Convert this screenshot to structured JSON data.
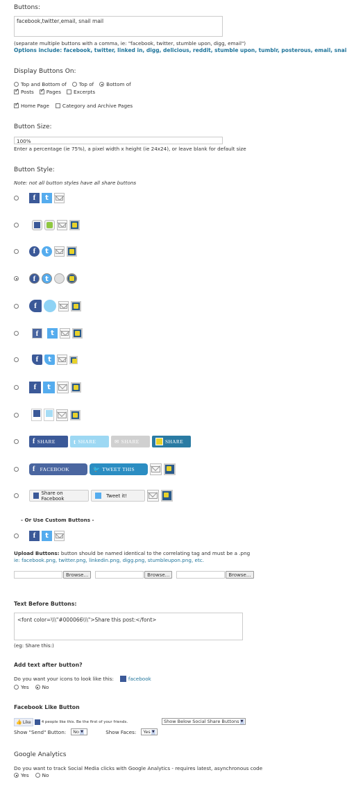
{
  "buttons": {
    "heading": "Buttons:",
    "value": "facebook,twitter,email, snail mail",
    "help": "(separate multiple buttons with a comma, ie: \"facebook, twitter, stumble upon, digg, email\")",
    "options": "Options include: facebook, twitter, linked in, digg, delicious, reddit, stumble upon, tumblr, posterous, email, snail mail,"
  },
  "display": {
    "heading": "Display Buttons On:",
    "positions": [
      "Top and Bottom of",
      "Top of",
      "Bottom of"
    ],
    "types": [
      "Posts",
      "Pages",
      "Excerpts"
    ],
    "home": "Home Page",
    "category": "Category and Archive Pages"
  },
  "size": {
    "heading": "Button Size:",
    "value": "100%",
    "help": "Enter a percentage (ie 75%), a pixel width x height (ie 24x24), or leave blank for default size"
  },
  "style": {
    "heading": "Button Style:",
    "note": "Note: not all button styles have all share buttons",
    "share": "SHARE",
    "facebook": "FACEBOOK",
    "tweet_this": "TWEET THIS",
    "share_on_facebook": "Share on Facebook",
    "tweet_it": "Tweet it!",
    "custom_heading": "- Or Use Custom Buttons -"
  },
  "upload": {
    "heading": "Upload Buttons:",
    "desc": "button should be named identical to the correlating tag and must be a .png",
    "examples": "ie: facebook.png, twitter.png, linkedin.png, digg.png, stumbleupon.png, etc.",
    "browse": "Browse..."
  },
  "text_before": {
    "heading": "Text Before Buttons:",
    "value": "<font color=\\\\\\\"#000066\\\\\\\">Share this post:</font>",
    "example": "(eg: Share this:)"
  },
  "after": {
    "heading": "Add text after button?",
    "question": "Do you want your icons to look like this:",
    "sample": "facebook",
    "yes": "Yes",
    "no": "No"
  },
  "fb_like": {
    "heading": "Facebook Like Button",
    "like": "Like",
    "like_text": "4 people like this. Be the first of your friends.",
    "position": "Show Below Social Share Buttons",
    "send_label": "Show \"Send\" Button:",
    "send_value": "No",
    "faces_label": "Show Faces:",
    "faces_value": "Yes"
  },
  "ga": {
    "heading": "Google Analytics",
    "question": "Do you want to track Social Media clicks with Google Analytics - requires latest, asynchronous code",
    "yes": "Yes",
    "no": "No"
  },
  "colors": {
    "link": "#21759b",
    "facebook": "#3b5998",
    "twitter": "#55acee"
  }
}
